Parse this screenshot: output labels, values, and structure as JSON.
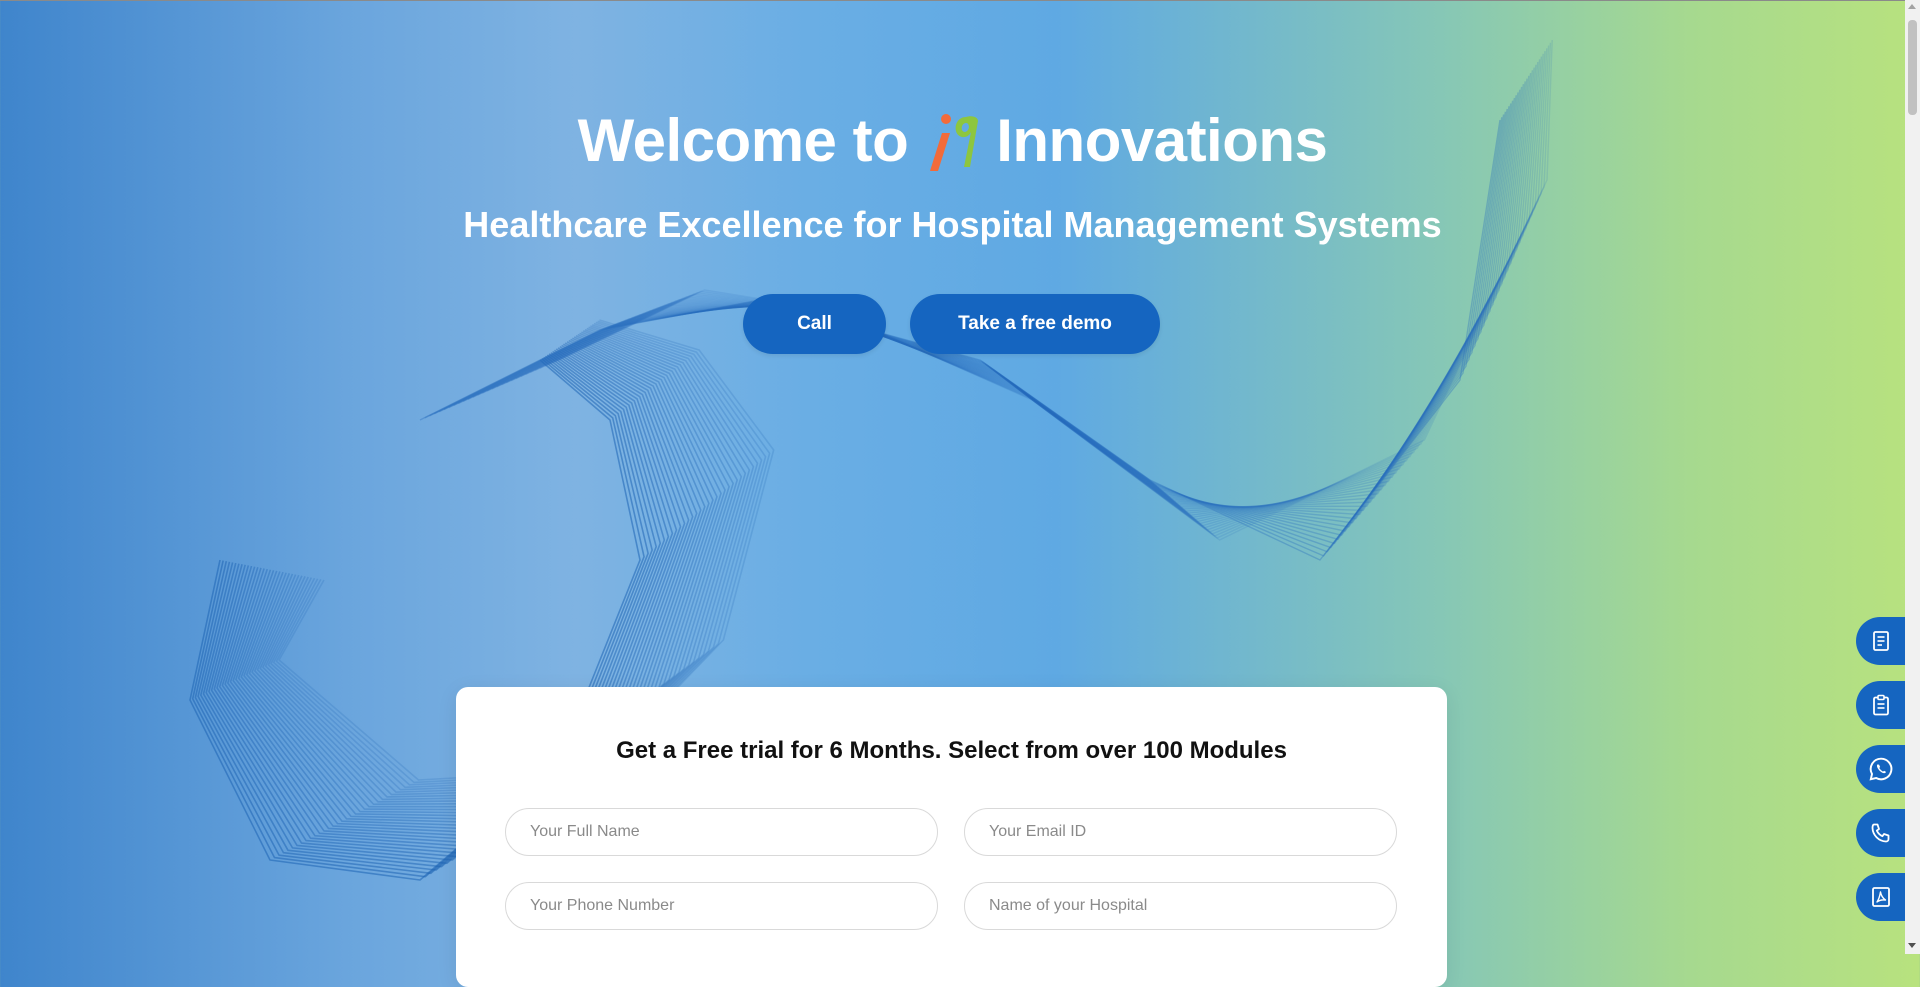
{
  "hero": {
    "title_prefix": "Welcome to",
    "title_suffix": "Innovations",
    "logo_icon": "i9-logo-icon",
    "subtitle": "Healthcare Excellence for Hospital Management Systems",
    "call_label": "Call",
    "demo_label": "Take a free demo"
  },
  "form": {
    "title": "Get a Free trial for 6 Months. Select from over 100 Modules",
    "full_name_placeholder": "Your Full Name",
    "email_placeholder": "Your Email ID",
    "phone_placeholder": "Your Phone Number",
    "hospital_placeholder": "Name of your Hospital"
  },
  "floating_actions": [
    {
      "icon": "document-icon"
    },
    {
      "icon": "clipboard-icon"
    },
    {
      "icon": "whatsapp-icon"
    },
    {
      "icon": "phone-icon"
    },
    {
      "icon": "pdf-icon"
    }
  ],
  "colors": {
    "primary_button": "#1565c0",
    "gradient_left": "#3f85cc",
    "gradient_right": "#b8e27e",
    "logo_orange": "#f26b3a",
    "logo_green": "#8dc63f"
  }
}
